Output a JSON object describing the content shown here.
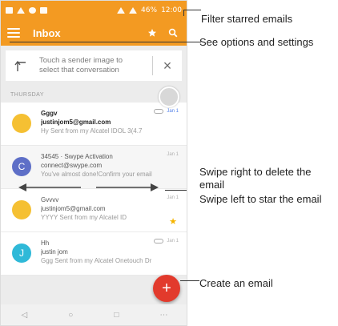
{
  "status_bar": {
    "time": "12:00",
    "battery": "46%"
  },
  "toolbar": {
    "title": "Inbox"
  },
  "tip": {
    "text": "Touch a sender image to select that conversation",
    "close": "×"
  },
  "section_label": "THURSDAY",
  "emails": [
    {
      "sender": "Gggv",
      "email": "justinjom5@gmail.com",
      "snippet": "Hy Sent from my Alcatel IDOL 3(4.7",
      "meta": "Jan 1",
      "avatar_color": "#f5c033",
      "avatar_letter": "",
      "starred": false,
      "read": false
    },
    {
      "sender": "34545 · Swype Activation",
      "email": "connect@swype.com",
      "snippet": "You've almost done!Confirm your email",
      "meta": "Jan 1",
      "avatar_color": "#5e6fc7",
      "avatar_letter": "C",
      "starred": false,
      "read": true
    },
    {
      "sender": "Gvvvv",
      "email": "justinjom5@gmail.com",
      "snippet": "YYYY Sent from my Alcatel ID",
      "meta": "Jan 1",
      "avatar_color": "#f5c033",
      "avatar_letter": "",
      "starred": true,
      "read": true
    },
    {
      "sender": "Hh",
      "email": "justin jom",
      "snippet": "Ggg Sent from my Alcatel Onetouch Dr",
      "meta": "Jan 1",
      "avatar_color": "#2fb9d8",
      "avatar_letter": "J",
      "starred": false,
      "read": true
    }
  ],
  "fab": {
    "label": "+"
  },
  "callouts": {
    "filter": "Filter starred emails",
    "options": "See options and settings",
    "swipe_delete_1": "Swipe right to delete the",
    "swipe_delete_2": "email",
    "swipe_star": "Swipe left to star the email",
    "create": "Create an email"
  },
  "colors": {
    "accent": "#f39a22",
    "fab": "#e23a2c",
    "star": "#f5b400"
  }
}
